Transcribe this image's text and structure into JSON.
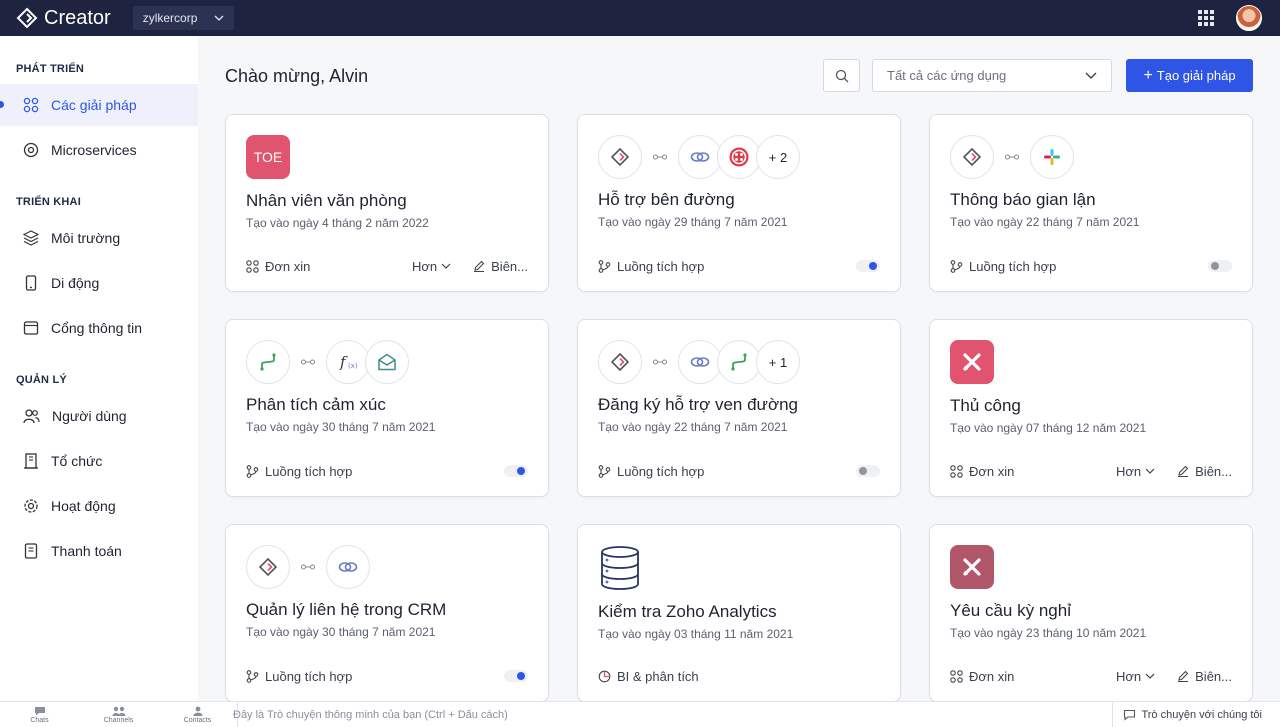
{
  "app": {
    "name": "Creator",
    "org": "zylkercorp"
  },
  "sidebar": {
    "sections": [
      {
        "title": "PHÁT TRIỂN"
      },
      {
        "title": "TRIỂN KHAI"
      },
      {
        "title": "QUẢN LÝ"
      }
    ],
    "items": [
      {
        "label": "Các giải pháp",
        "icon": "solutions-icon",
        "active": true
      },
      {
        "label": "Microservices",
        "icon": "microservices-icon"
      },
      {
        "label": "Môi trường",
        "icon": "environment-icon"
      },
      {
        "label": "Di động",
        "icon": "mobile-icon"
      },
      {
        "label": "Cổng thông tin",
        "icon": "portal-icon"
      },
      {
        "label": "Người dùng",
        "icon": "users-icon"
      },
      {
        "label": "Tổ chức",
        "icon": "organization-icon"
      },
      {
        "label": "Hoạt động",
        "icon": "operations-icon"
      },
      {
        "label": "Thanh toán",
        "icon": "billing-icon"
      }
    ]
  },
  "main": {
    "welcome": "Chào mừng, Alvin",
    "app_filter": "Tất cả các ứng dụng",
    "create_label": "Tạo giải pháp"
  },
  "cards": [
    {
      "title": "Nhân viên văn phòng",
      "date": "Tạo vào ngày 4 tháng 2 năm 2022",
      "type": "Đơn xin",
      "tile_text": "TOE",
      "tile_color": "#e0546f",
      "more_label": "Hơn",
      "edit_label": "Biên..."
    },
    {
      "title": "Hỗ trợ bên đường",
      "date": "Tạo vào ngày 29 tháng 7 năm 2021",
      "type": "Luồng tích hợp",
      "extra_count": "+ 2",
      "toggle": "on"
    },
    {
      "title": "Thông báo gian lận",
      "date": "Tạo vào ngày 22 tháng 7 năm 2021",
      "type": "Luồng tích hợp",
      "toggle": "off"
    },
    {
      "title": "Phân tích cảm xúc",
      "date": "Tạo vào ngày 30 tháng 7 năm 2021",
      "type": "Luồng tích hợp",
      "toggle": "on"
    },
    {
      "title": "Đăng ký hỗ trợ ven đường",
      "date": "Tạo vào ngày 22 tháng 7 năm 2021",
      "type": "Luồng tích hợp",
      "extra_count": "+ 1",
      "toggle": "off"
    },
    {
      "title": "Thủ công",
      "date": "Tạo vào ngày 07 tháng 12 năm 2021",
      "type": "Đơn xin",
      "tile_color": "#e0546f",
      "more_label": "Hơn",
      "edit_label": "Biên..."
    },
    {
      "title": "Quản lý liên hệ trong CRM",
      "date": "Tạo vào ngày 30 tháng 7 năm 2021",
      "type": "Luồng tích hợp",
      "toggle": "on"
    },
    {
      "title": "Kiểm tra Zoho Analytics",
      "date": "Tạo vào ngày 03 tháng 11 năm 2021",
      "type": "BI & phân tích"
    },
    {
      "title": "Yêu cầu kỳ nghỉ",
      "date": "Tạo vào ngày 23 tháng 10 năm 2021",
      "type": "Đơn xin",
      "tile_color": "#b2566a",
      "more_label": "Hơn",
      "edit_label": "Biên..."
    }
  ],
  "bottombar": {
    "chats": "Chats",
    "channels": "Channels",
    "contacts": "Contacts",
    "chat_placeholder": "Đây là Trò chuyện thông minh của bạn (Ctrl + Dấu cách)",
    "chat_with_us": "Trò chuyện với chúng tôi"
  },
  "colors": {
    "accent": "#2e55e6",
    "topbar": "#1e2340"
  }
}
